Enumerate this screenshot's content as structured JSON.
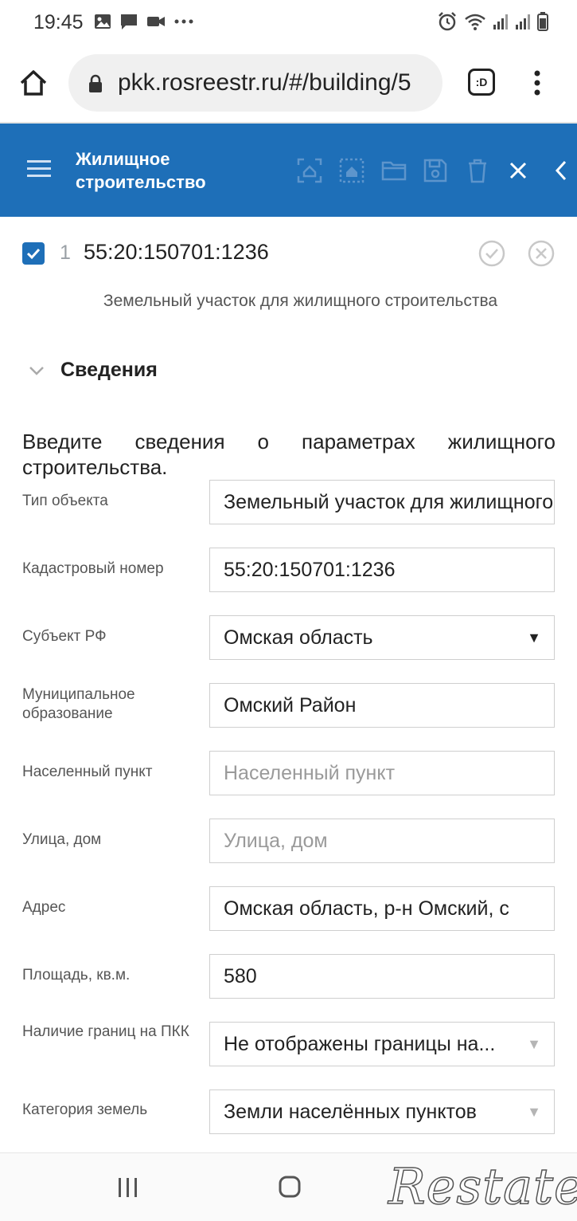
{
  "status_bar": {
    "time": "19:45",
    "left_icons": [
      "image-icon",
      "message-icon",
      "video-icon",
      "more-dots-icon"
    ],
    "right_icons": [
      "alarm-icon",
      "wifi-icon",
      "signal-icon",
      "signal-icon",
      "battery-icon"
    ]
  },
  "browser": {
    "url": "pkk.rosreestr.ru/#/building/5",
    "tabs_label": ":D"
  },
  "app_bar": {
    "title": "Жилищное строительство",
    "color": "#1e6fb8",
    "tools": [
      "scan-area-icon",
      "select-area-icon",
      "folder-icon",
      "save-icon",
      "delete-icon",
      "close-icon",
      "collapse-icon"
    ]
  },
  "object": {
    "index": "1",
    "cadastral_number": "55:20:150701:1236",
    "description": "Земельный участок для жилищного строительства",
    "checked": true
  },
  "section": {
    "title": "Сведения",
    "intro": "Введите сведения о параметрах жилищного строительства."
  },
  "fields": [
    {
      "label": "Тип объекта",
      "value": "Земельный участок для жилищного строительства",
      "placeholder": ""
    },
    {
      "label": "Кадастровый номер",
      "value": "55:20:150701:1236",
      "placeholder": ""
    },
    {
      "label": "Субъект РФ",
      "value": "Омская область",
      "placeholder": ""
    },
    {
      "label": "Муниципальное образование",
      "value": "Омский Район",
      "placeholder": ""
    },
    {
      "label": "Населенный пункт",
      "value": "",
      "placeholder": "Населенный пункт"
    },
    {
      "label": "Улица, дом",
      "value": "",
      "placeholder": "Улица, дом"
    },
    {
      "label": "Адрес",
      "value": "Омская область, р-н Омский, с",
      "placeholder": ""
    },
    {
      "label": "Площадь, кв.м.",
      "value": "580",
      "placeholder": ""
    },
    {
      "label": "Наличие границ на ПКК",
      "value": "Не отображены границы на...",
      "placeholder": ""
    },
    {
      "label": "Категория земель",
      "value": "Земли населённых пунктов",
      "placeholder": ""
    }
  ],
  "watermark": "Restate"
}
